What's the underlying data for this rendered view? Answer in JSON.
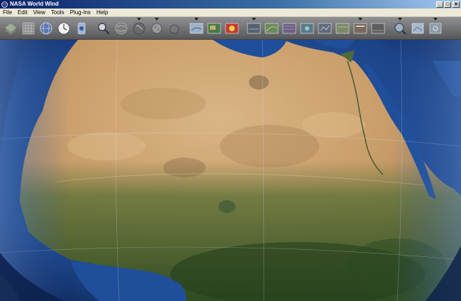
{
  "window": {
    "title": "NASA World Wind"
  },
  "window_buttons": {
    "minimize": "_",
    "maximize": "□",
    "close": "✕"
  },
  "menu": [
    {
      "label": "File"
    },
    {
      "label": "Edit"
    },
    {
      "label": "View"
    },
    {
      "label": "Tools"
    },
    {
      "label": "Plug-Ins"
    },
    {
      "label": "Help"
    }
  ],
  "toolbar": {
    "buttons": [
      {
        "icon": "layer-manager-icon"
      },
      {
        "icon": "grid-lines-icon"
      },
      {
        "icon": "globe-icon"
      },
      {
        "icon": "clock-icon"
      },
      {
        "icon": "placename-icon"
      },
      {
        "icon": "search-icon"
      },
      {
        "icon": "boundaries-icon"
      },
      {
        "icon": "earth-icon"
      },
      {
        "icon": "moon-icon"
      },
      {
        "icon": "mars-icon"
      },
      {
        "icon": "layer-overlay-icon-1"
      },
      {
        "icon": "layer-overlay-icon-2"
      },
      {
        "icon": "layer-overlay-icon-3"
      },
      {
        "icon": "layer-overlay-icon-4"
      },
      {
        "icon": "layer-overlay-icon-5"
      },
      {
        "icon": "layer-overlay-icon-6"
      },
      {
        "icon": "layer-overlay-icon-7"
      },
      {
        "icon": "layer-overlay-icon-8"
      },
      {
        "icon": "layer-overlay-icon-9"
      },
      {
        "icon": "layer-overlay-icon-10"
      },
      {
        "icon": "layer-overlay-icon-11"
      },
      {
        "icon": "zoom-icon"
      },
      {
        "icon": "map-icon"
      },
      {
        "icon": "settings-icon"
      }
    ]
  },
  "colors": {
    "ocean": "#1f4f9a",
    "desert": "#c9a374",
    "vegetation": "#3c5a2a"
  }
}
